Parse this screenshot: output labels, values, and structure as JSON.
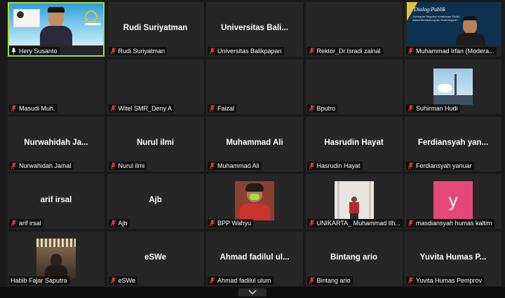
{
  "participants": [
    {
      "name": "Hery Susanto",
      "mic": "on",
      "display": "video",
      "center": ""
    },
    {
      "name": "Rudi Suriyatman",
      "mic": "muted",
      "display": "name",
      "center": "Rudi Suriyatman"
    },
    {
      "name": "Universitas Balikpapan",
      "mic": "muted",
      "display": "name",
      "center": "Universitas  Bali..."
    },
    {
      "name": "Rektor_Dr.Isradi zainal",
      "mic": "muted",
      "display": "blank",
      "center": ""
    },
    {
      "name": "Muhammad Irfan (Modera...",
      "mic": "muted",
      "display": "video",
      "center": ""
    },
    {
      "name": "Masudi Muh.",
      "mic": "muted",
      "display": "blank",
      "center": ""
    },
    {
      "name": "Witel SMR_Deny A",
      "mic": "muted",
      "display": "blank",
      "center": ""
    },
    {
      "name": "Faizal",
      "mic": "muted",
      "display": "blank",
      "center": ""
    },
    {
      "name": "Bputro",
      "mic": "muted",
      "display": "blank",
      "center": ""
    },
    {
      "name": "Suhirman Hudi",
      "mic": "muted",
      "display": "video",
      "center": ""
    },
    {
      "name": "Nurwahidah Jamal",
      "mic": "muted",
      "display": "name",
      "center": "Nurwahidah  Ja..."
    },
    {
      "name": "Nurul ilmi",
      "mic": "muted",
      "display": "name",
      "center": "Nurul ilmi"
    },
    {
      "name": "Muhammad Ali",
      "mic": "muted",
      "display": "name",
      "center": "Muhammad Ali"
    },
    {
      "name": "Hasrudin Hayat",
      "mic": "muted",
      "display": "name",
      "center": "Hasrudin Hayat"
    },
    {
      "name": "Ferdiansyah yanuar",
      "mic": "muted",
      "display": "name",
      "center": "Ferdiansyah  yan..."
    },
    {
      "name": "arif irsal",
      "mic": "muted",
      "display": "name",
      "center": "arif irsal"
    },
    {
      "name": "Ajb",
      "mic": "muted",
      "display": "name",
      "center": "Ajb"
    },
    {
      "name": "BPP Wahyu",
      "mic": "muted",
      "display": "video",
      "center": ""
    },
    {
      "name": "UNIKARTA_ Muhammad Ilh...",
      "mic": "muted",
      "display": "video",
      "center": ""
    },
    {
      "name": "masdiansyah humas kaltim",
      "mic": "muted",
      "display": "avatar",
      "center": "y"
    },
    {
      "name": "Habib Fajar Saputra",
      "mic": "none",
      "display": "video",
      "center": ""
    },
    {
      "name": "eSWe",
      "mic": "muted",
      "display": "name",
      "center": "eSWe"
    },
    {
      "name": "Ahmad fadilul ulum",
      "mic": "muted",
      "display": "name",
      "center": "Ahmad fadilul ul..."
    },
    {
      "name": "Bintang ario",
      "mic": "muted",
      "display": "name",
      "center": "Bintang ario"
    },
    {
      "name": "Yuvita Humas Pemprov",
      "mic": "muted",
      "display": "name",
      "center": "Yuvita Humas P..."
    }
  ],
  "slide": {
    "title": "Dialog Publik",
    "subtitle": "\"Kesiapan Regulasi Ketahanan Publik dalam Mendukung Ibu Kota Negara\""
  },
  "colors": {
    "active_border": "#a8d94c",
    "mute_icon": "#e0383e",
    "tile_bg": "#262626",
    "avatar_pink": "#e4487a"
  }
}
